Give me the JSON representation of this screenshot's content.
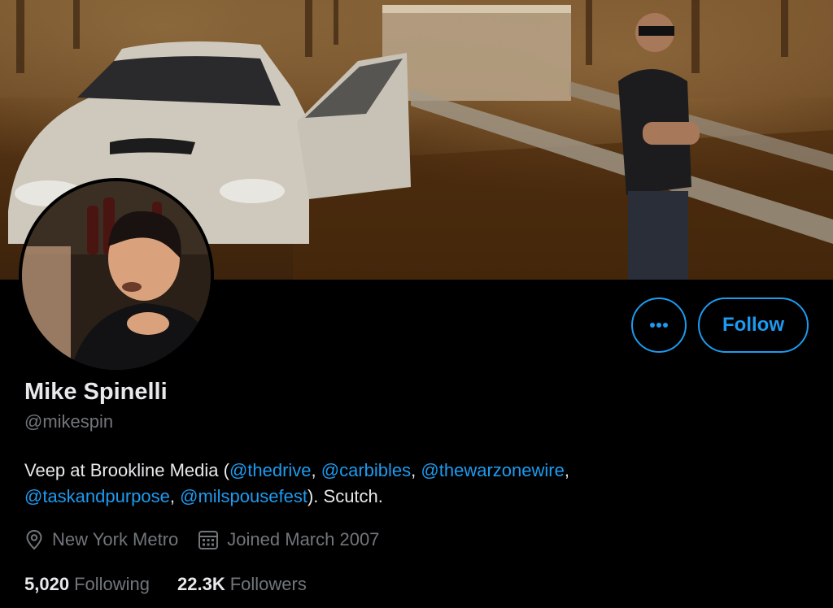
{
  "profile": {
    "name": "Mike Spinelli",
    "handle": "@mikespin",
    "bio": {
      "prefix": "Veep at Brookline Media (",
      "mentions": [
        "@thedrive",
        "@carbibles",
        "@thewarzonewire",
        "@taskandpurpose",
        "@milspousefest"
      ],
      "separator": ", ",
      "suffix": "). Scutch."
    },
    "location": "New York Metro",
    "joined": "Joined March 2007",
    "following_count": "5,020",
    "following_label": "Following",
    "followers_count": "22.3K",
    "followers_label": "Followers"
  },
  "actions": {
    "follow_label": "Follow",
    "more_icon": "more-horizontal-icon"
  },
  "colors": {
    "accent": "#1d9bf0",
    "background": "#000000",
    "secondary_text": "#71767b",
    "primary_text": "#e7e9ea"
  }
}
